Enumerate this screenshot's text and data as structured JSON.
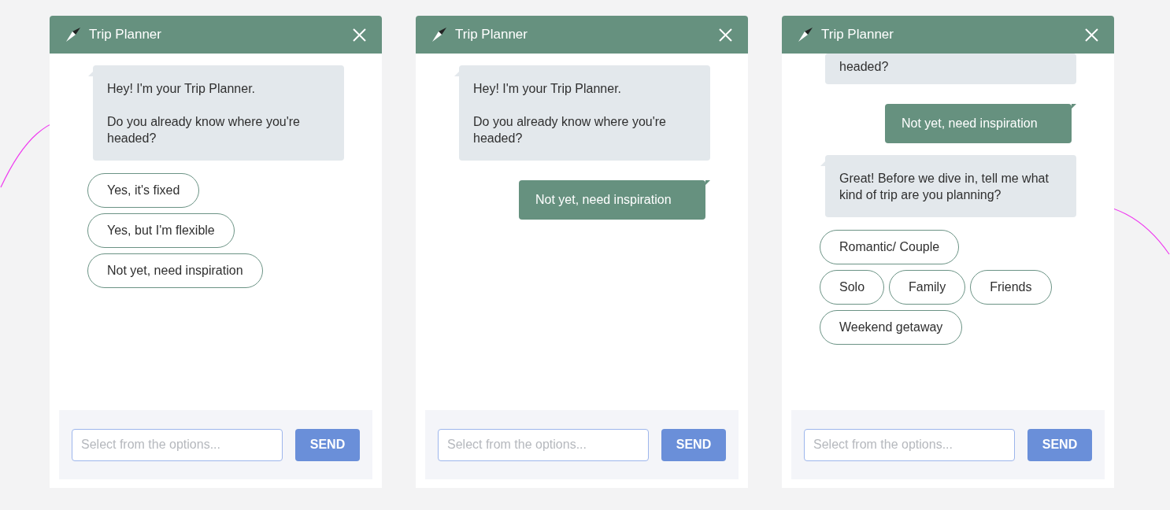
{
  "panels": [
    {
      "title": "Trip Planner",
      "messages": [
        {
          "kind": "bot",
          "text": "Hey! I'm your Trip Planner.\n\nDo you already know where you're headed?"
        }
      ],
      "option_rows": [
        [
          "Yes, it's fixed"
        ],
        [
          "Yes, but I'm flexible"
        ],
        [
          "Not yet, need inspiration"
        ]
      ],
      "input": {
        "placeholder": "Select from the options..."
      },
      "send_button": "SEND"
    },
    {
      "title": "Trip Planner",
      "messages": [
        {
          "kind": "bot",
          "text": "Hey! I'm your Trip Planner.\n\nDo you already know where you're headed?"
        },
        {
          "kind": "user",
          "text": "Not yet, need inspiration"
        }
      ],
      "input": {
        "placeholder": "Select from the options..."
      },
      "send_button": "SEND"
    },
    {
      "title": "Trip Planner",
      "messages": [
        {
          "kind": "bot_clipped",
          "text": "headed?"
        },
        {
          "kind": "user",
          "text": "Not yet, need inspiration"
        },
        {
          "kind": "bot",
          "text": "Great! Before we dive in, tell me what kind of trip are you planning?"
        }
      ],
      "option_rows": [
        [
          "Romantic/ Couple"
        ],
        [
          "Solo",
          "Family",
          "Friends"
        ],
        [
          "Weekend getaway"
        ]
      ],
      "input": {
        "placeholder": "Select from the options..."
      },
      "send_button": "SEND"
    }
  ]
}
